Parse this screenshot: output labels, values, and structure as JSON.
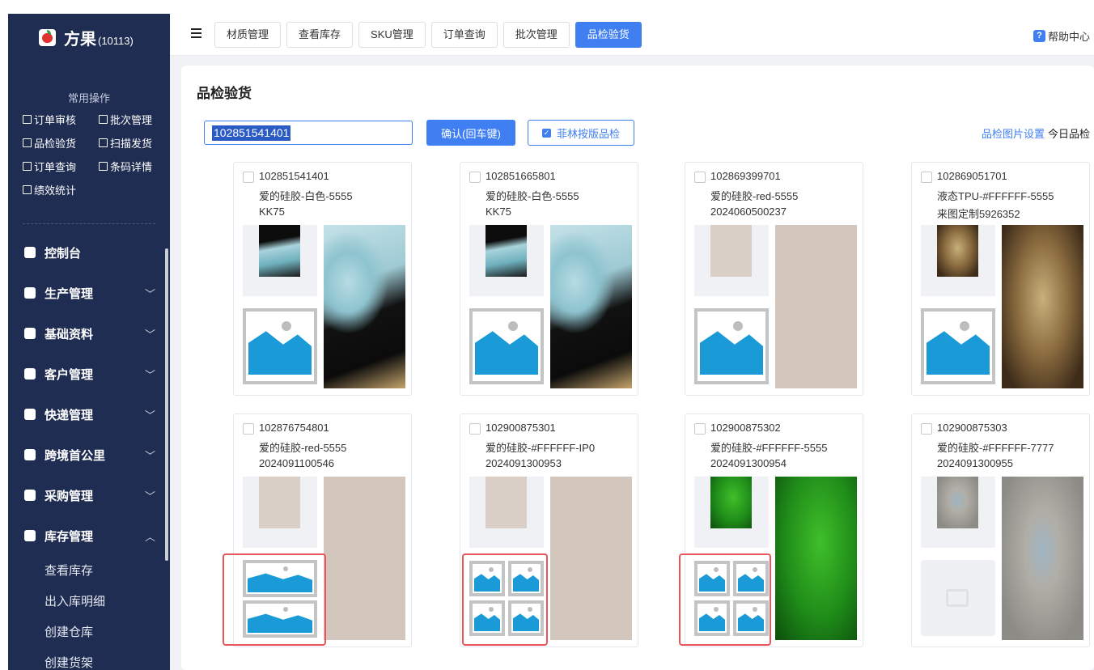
{
  "app": {
    "brand": "方果",
    "org_code": "(10113)"
  },
  "sidebar": {
    "quick_title": "常用操作",
    "quick_items": [
      {
        "label": "订单审核",
        "icon": "checkbox-icon"
      },
      {
        "label": "批次管理",
        "icon": "batch-icon"
      },
      {
        "label": "品检验货",
        "icon": "inspect-icon"
      },
      {
        "label": "扫描发货",
        "icon": "scan-icon"
      },
      {
        "label": "订单查询",
        "icon": "search-doc-icon"
      },
      {
        "label": "条码详情",
        "icon": "barcode-icon"
      },
      {
        "label": "绩效统计",
        "icon": "stats-icon"
      }
    ],
    "nav": [
      {
        "label": "控制台",
        "icon": "dashboard-icon"
      },
      {
        "label": "生产管理",
        "icon": "factory-icon",
        "chevron": "﹀"
      },
      {
        "label": "基础资料",
        "icon": "database-icon",
        "chevron": "﹀"
      },
      {
        "label": "客户管理",
        "icon": "users-icon",
        "chevron": "﹀"
      },
      {
        "label": "快递管理",
        "icon": "truck-icon",
        "chevron": "﹀"
      },
      {
        "label": "跨境首公里",
        "icon": "globe-icon",
        "chevron": "﹀"
      },
      {
        "label": "采购管理",
        "icon": "cart-icon",
        "chevron": "﹀"
      },
      {
        "label": "库存管理",
        "icon": "warehouse-icon",
        "chevron": "︿"
      }
    ],
    "sub_items": [
      "查看库存",
      "出入库明细",
      "创建仓库",
      "创建货架"
    ]
  },
  "topbar": {
    "tabs": [
      "材质管理",
      "查看库存",
      "SKU管理",
      "订单查询",
      "批次管理",
      "品检验货"
    ],
    "active_tab": "品检验货",
    "help_label": "帮助中心"
  },
  "page": {
    "title": "品检验货",
    "scan_value": "102851541401",
    "confirm_label": "确认(回车键)",
    "check_option_label": "菲林按版品检",
    "check_option_checked": true,
    "image_settings_link": "品检图片设置",
    "today_label": "今日品检"
  },
  "cards": [
    {
      "order": "102851541401",
      "product": "爱的硅胶-白色-5555",
      "note": "KK75",
      "art": "marble",
      "placeholder": "single"
    },
    {
      "order": "102851665801",
      "product": "爱的硅胶-白色-5555",
      "note": "KK75",
      "art": "marble",
      "placeholder": "single"
    },
    {
      "order": "102869399701",
      "product": "爱的硅胶-red-5555",
      "note": "2024060500237",
      "art": "beige",
      "placeholder": "single"
    },
    {
      "order": "102869051701",
      "product": "液态TPU-#FFFFFF-5555",
      "note": "来图定制5926352",
      "art": "warrior",
      "placeholder": "single"
    },
    {
      "order": "102876754801",
      "product": "爱的硅胶-red-5555",
      "note": "2024091100546",
      "art": "beige",
      "placeholder": "double"
    },
    {
      "order": "102900875301",
      "product": "爱的硅胶-#FFFFFF-IP0",
      "note": "2024091300953",
      "art": "beige",
      "placeholder": "quad"
    },
    {
      "order": "102900875302",
      "product": "爱的硅胶-#FFFFFF-5555",
      "note": "2024091300954",
      "art": "green",
      "placeholder": "quad"
    },
    {
      "order": "102900875303",
      "product": "爱的硅胶-#FFFFFF-7777",
      "note": "2024091300955",
      "art": "grey-dragon",
      "placeholder": "empty"
    }
  ],
  "colors": {
    "primary": "#3f7ff2",
    "sidebar": "#1f2d52",
    "highlight": "#e8565c"
  }
}
